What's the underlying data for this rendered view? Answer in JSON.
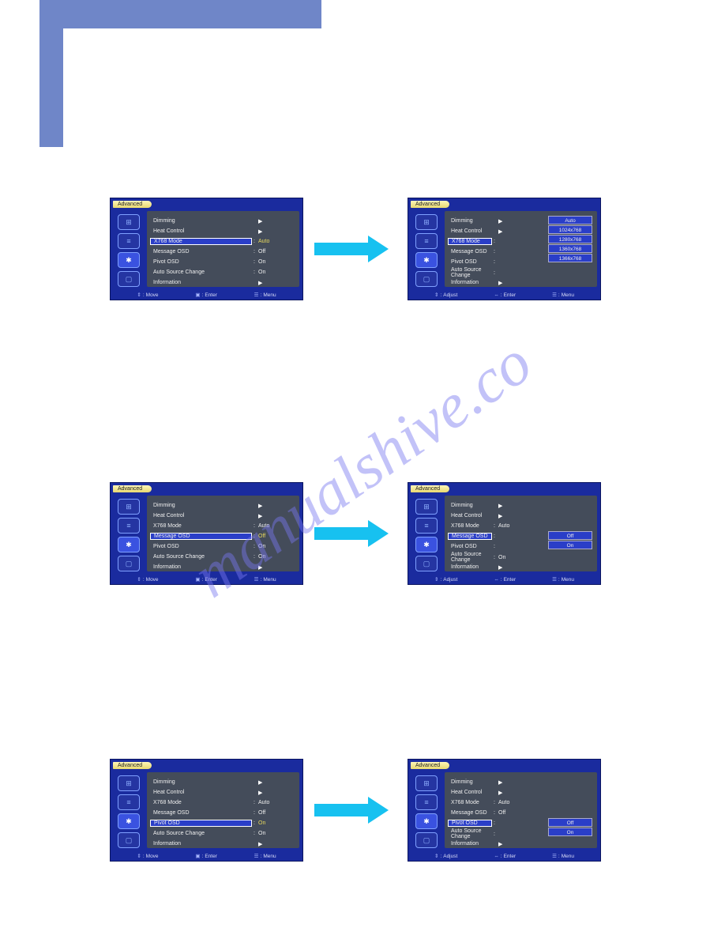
{
  "watermark": "manualshive.co",
  "panel_title": "Advanced",
  "sidebar_icons": [
    "settings-icon",
    "sliders-icon",
    "globe-icon",
    "tv-icon"
  ],
  "footer_left_move": "Move",
  "footer_left_adjust": "Adjust",
  "footer_enter": "Enter",
  "footer_menu": "Menu",
  "menu_labels": {
    "dimming": "Dimming",
    "heat": "Heat Control",
    "x768": "X768 Mode",
    "msgosd": "Message OSD",
    "pivot": "Pivot OSD",
    "autosrc": "Auto Source Change",
    "info": "Information"
  },
  "vals": {
    "auto": "Auto",
    "off": "Off",
    "on": "On"
  },
  "arrow_glyph": "▶",
  "opts_x768": [
    "Auto",
    "1024x768",
    "1280x768",
    "1360x768",
    "1366x768"
  ],
  "opts_onoff": [
    "Off",
    "On"
  ]
}
